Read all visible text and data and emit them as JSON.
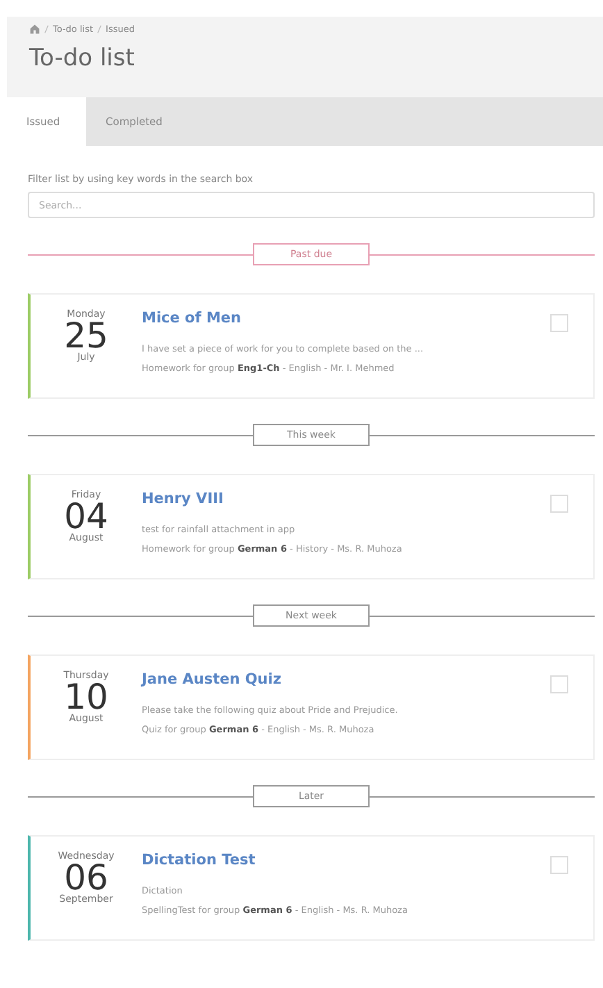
{
  "breadcrumb": [
    "To-do list",
    "Issued"
  ],
  "title": "To-do list",
  "tabs": [
    {
      "label": "Issued",
      "selected": true
    },
    {
      "label": "Completed",
      "selected": false
    }
  ],
  "filter_hint": "Filter list by using key words in the search box",
  "search": {
    "placeholder": "Search..."
  },
  "sections": [
    {
      "label": "Past due",
      "color": "#e8a0b4",
      "items": [
        {
          "weekday": "Monday",
          "day": "25",
          "month": "July",
          "title": "Mice of Men",
          "description": "I have set a piece of work for you to complete based on the ...",
          "meta": "Homework for group **Eng1-Ch** - English - Mr. I. Mehmed",
          "color": "#9ccc65",
          "checked": false
        }
      ]
    },
    {
      "label": "This week",
      "color": "#9a9a9a",
      "items": [
        {
          "weekday": "Friday",
          "day": "04",
          "month": "August",
          "title": "Henry VIII",
          "description": "test for rainfall attachment in app",
          "meta": "Homework for group **German 6** - History - Ms. R. Muhoza",
          "color": "#9ccc65",
          "checked": false
        }
      ]
    },
    {
      "label": "Next week",
      "color": "#9a9a9a",
      "items": [
        {
          "weekday": "Thursday",
          "day": "10",
          "month": "August",
          "title": "Jane Austen Quiz",
          "description": "Please take the following quiz about Pride and Prejudice.",
          "meta": "Quiz for group **German 6** - English - Ms. R. Muhoza",
          "color": "#f4a460",
          "checked": false
        }
      ]
    },
    {
      "label": "Later",
      "color": "#9a9a9a",
      "items": [
        {
          "weekday": "Wednesday",
          "day": "06",
          "month": "September",
          "title": "Dictation Test",
          "description": "Dictation",
          "meta": "SpellingTest for group **German 6** - English - Ms. R. Muhoza",
          "color": "#4db6ac",
          "checked": false
        }
      ]
    }
  ]
}
